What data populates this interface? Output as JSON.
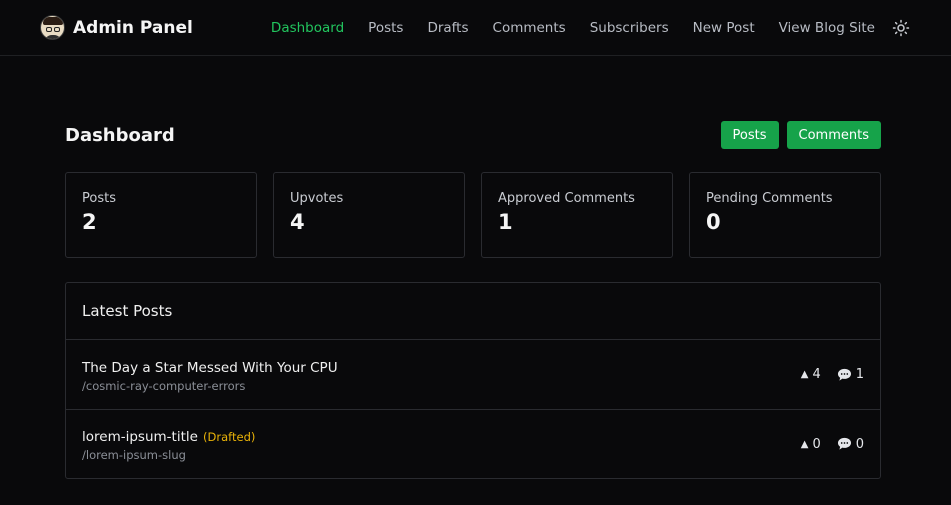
{
  "header": {
    "title": "Admin Panel",
    "nav": [
      {
        "label": "Dashboard",
        "active": true
      },
      {
        "label": "Posts"
      },
      {
        "label": "Drafts"
      },
      {
        "label": "Comments"
      },
      {
        "label": "Subscribers"
      },
      {
        "label": "New Post"
      },
      {
        "label": "View Blog Site"
      }
    ],
    "theme_icon": "sun-icon"
  },
  "page": {
    "title": "Dashboard",
    "actions": {
      "posts": "Posts",
      "comments": "Comments"
    }
  },
  "stats": [
    {
      "label": "Posts",
      "value": "2"
    },
    {
      "label": "Upvotes",
      "value": "4"
    },
    {
      "label": "Approved Comments",
      "value": "1"
    },
    {
      "label": "Pending Comments",
      "value": "0"
    }
  ],
  "latest_posts": {
    "title": "Latest Posts",
    "items": [
      {
        "title": "The Day a Star Messed With Your CPU",
        "tag": "",
        "slug": "/cosmic-ray-computer-errors",
        "upvotes": "4",
        "comments": "1"
      },
      {
        "title": "lorem-ipsum-title",
        "tag": "(Drafted)",
        "slug": "/lorem-ipsum-slug",
        "upvotes": "0",
        "comments": "0"
      }
    ]
  },
  "colors": {
    "accent": "#22c55e",
    "button": "#16a34a",
    "draft": "#eab308",
    "background": "#09090b"
  }
}
